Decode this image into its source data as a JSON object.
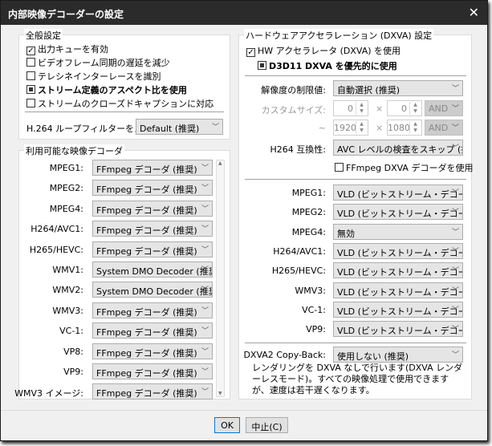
{
  "window": {
    "title": "内部映像デコーダーの設定",
    "close": "✕"
  },
  "general": {
    "title": "全般設定",
    "options": [
      {
        "label": "出力キューを有効",
        "state": "checked"
      },
      {
        "label": "ビデオフレーム同期の遅延を減少",
        "state": "unchecked"
      },
      {
        "label": "テレシネインターレースを識別",
        "state": "unchecked"
      },
      {
        "label": "ストリーム定義のアスペクト比を使用",
        "state": "indeterminate"
      },
      {
        "label": "ストリームのクローズドキャプションに対応",
        "state": "unchecked"
      }
    ],
    "h264_label": "H.264 ループフィルターをスキッ",
    "h264_value": "Default (推奨)"
  },
  "decoders": {
    "title": "利用可能な映像デコーダ",
    "rows": [
      {
        "label": "MPEG1:",
        "value": "FFmpeg デコーダ (推奨)"
      },
      {
        "label": "MPEG2:",
        "value": "FFmpeg デコーダ (推奨)"
      },
      {
        "label": "MPEG4:",
        "value": "FFmpeg デコーダ (推奨)"
      },
      {
        "label": "H264/AVC1:",
        "value": "FFmpeg デコーダ (推奨)"
      },
      {
        "label": "H265/HEVC:",
        "value": "FFmpeg デコーダ (推奨)"
      },
      {
        "label": "WMV1:",
        "value": "System DMO Decoder (推奨"
      },
      {
        "label": "WMV2:",
        "value": "System DMO Decoder (推奨"
      },
      {
        "label": "WMV3:",
        "value": "FFmpeg デコーダ (推奨)"
      },
      {
        "label": "VC-1:",
        "value": "FFmpeg デコーダ (推奨)"
      },
      {
        "label": "VP8:",
        "value": "FFmpeg デコーダ (推奨)"
      },
      {
        "label": "VP9:",
        "value": "FFmpeg デコーダ (推奨)"
      },
      {
        "label": "WMV3 イメージ:",
        "value": "FFmpeg デコーダ (推奨)"
      }
    ]
  },
  "dxva": {
    "title": "ハードウェアアクセラレーション (DXVA) 設定",
    "hw_label": "HW アクセラレータ (DXVA) を使用",
    "hw_state": "checked",
    "d3d11_label": "D3D11 DXVA を優先的に使用",
    "d3d11_state": "indeterminate",
    "res_label": "解像度の制限値:",
    "res_value": "自動選択 (推奨)",
    "custom_label": "カスタムサイズ:",
    "custom_w": "0",
    "custom_h": "0",
    "custom_op": "AND",
    "tilde": "~",
    "max_w": "1920",
    "max_h": "1080",
    "max_op": "AND",
    "times": "×",
    "h264_label": "H264 互換性:",
    "h264_value": "AVC レベルの検査をスキップ (推",
    "ffmpeg_label": "FFmpeg DXVA デコーダを使用",
    "ffmpeg_state": "unchecked",
    "rows": [
      {
        "label": "MPEG1:",
        "value": "VLD (ビットストリーム・デコーディ"
      },
      {
        "label": "MPEG2:",
        "value": "VLD (ビットストリーム・デコーディ"
      },
      {
        "label": "MPEG4:",
        "value": "無効"
      },
      {
        "label": "H264/AVC1:",
        "value": "VLD (ビットストリーム・デコーディ"
      },
      {
        "label": "H265/HEVC:",
        "value": "VLD (ビットストリーム・デコーディ"
      },
      {
        "label": "WMV3:",
        "value": "VLD (ビットストリーム・デコーディ"
      },
      {
        "label": "VC-1:",
        "value": "VLD (ビットストリーム・デコーディ"
      },
      {
        "label": "VP9:",
        "value": "VLD (ビットストリーム・デコーディ"
      }
    ],
    "copyback_label": "DXVA2 Copy-Back:",
    "copyback_value": "使用しない (推奨)",
    "note": "レンダリングを DXVA なしで行います(DXVA レンダーレスモード)。すべての映像処理で使用できますが、速度は若干遅くなります。"
  },
  "buttons": {
    "ok": "OK",
    "cancel": "中止(C)"
  }
}
